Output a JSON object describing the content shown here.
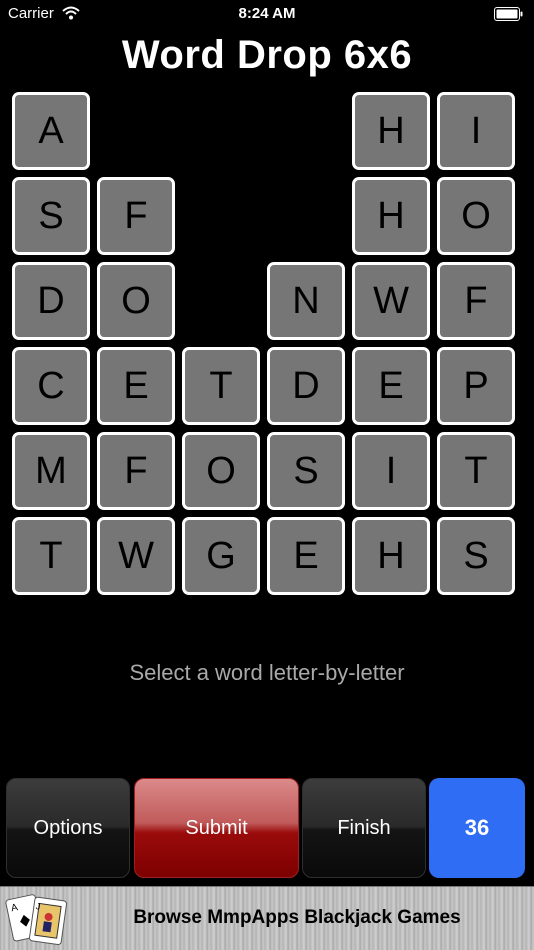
{
  "status": {
    "carrier": "Carrier",
    "time": "8:24 AM"
  },
  "title": "Word Drop 6x6",
  "board": {
    "rows": [
      [
        "A",
        "",
        "",
        "",
        "H",
        "I"
      ],
      [
        "S",
        "F",
        "",
        "",
        "H",
        "O"
      ],
      [
        "D",
        "O",
        "",
        "N",
        "W",
        "F"
      ],
      [
        "C",
        "E",
        "T",
        "D",
        "E",
        "P"
      ],
      [
        "M",
        "F",
        "O",
        "S",
        "I",
        "T"
      ],
      [
        "T",
        "W",
        "G",
        "E",
        "H",
        "S"
      ]
    ]
  },
  "hint": "Select a word letter-by-letter",
  "buttons": {
    "options": "Options",
    "submit": "Submit",
    "finish": "Finish",
    "count": "36"
  },
  "ad": {
    "text": "Browse MmpApps Blackjack Games"
  },
  "colors": {
    "background": "#000000",
    "tile": "#767676",
    "tile_border": "#ffffff",
    "submit": "#9a0b0b",
    "count_button": "#2f6df5"
  }
}
